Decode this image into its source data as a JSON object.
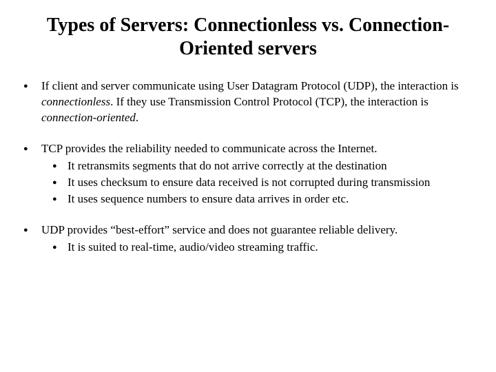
{
  "title": "Types of Servers: Connectionless vs. Connection-Oriented servers",
  "bullets": [
    {
      "pre": "If client and server communicate using User Datagram Protocol (UDP), the interaction is ",
      "em1": "connectionless",
      "mid": ". If they use Transmission Control Protocol (TCP), the interaction is ",
      "em2": "connection-oriented",
      "post": "."
    },
    {
      "text": "TCP provides the reliability needed to communicate across the Internet.",
      "sub": [
        "It retransmits segments that do not arrive correctly at the destination",
        "It uses checksum to ensure data received is not corrupted during transmission",
        "It uses sequence numbers to ensure data arrives in order etc."
      ]
    },
    {
      "text": "UDP provides “best-effort” service and does not guarantee reliable delivery.",
      "sub": [
        "It is suited to real-time, audio/video streaming traffic."
      ]
    }
  ]
}
